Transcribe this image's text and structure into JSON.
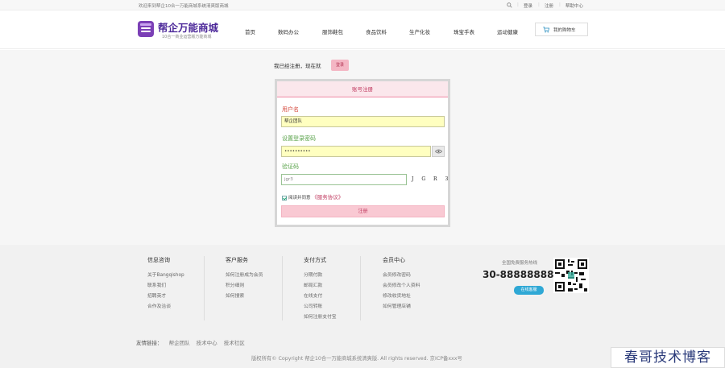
{
  "topbar": {
    "welcome": "欢迎来到帮企10合一万能商城系统清爽版商城",
    "login": "登录",
    "register": "注册",
    "help": "帮助中心"
  },
  "header": {
    "logo_name": "帮企万能商城",
    "logo_sub": "10合一商业运营版万能商城",
    "nav": [
      "首页",
      "数码办公",
      "服饰鞋包",
      "食品饮料",
      "生产化妆",
      "珠宝手表",
      "运动健康"
    ],
    "cart_label": "我的购物车"
  },
  "main": {
    "already_text": "我已经注册，现在就",
    "login_button": "登录",
    "tab_title": "账号注册",
    "username_label": "用户名",
    "username_value": "帮企团队",
    "password_label": "设置登录密码",
    "password_value": "••••••••••",
    "captcha_label": "验证码",
    "captcha_value": "jgr3",
    "captcha_image_text": "J G R 3",
    "agree_text": "阅读并同意",
    "terms_link": "《服务协议》",
    "submit_label": "注册"
  },
  "footer": {
    "columns": [
      {
        "title": "信息咨询",
        "links": [
          "关于Bangqishop",
          "联系我们",
          "招聘英才",
          "合作及洽谈"
        ]
      },
      {
        "title": "客户服务",
        "links": [
          "如何注册成为会员",
          "积分细则",
          "如何搜索"
        ]
      },
      {
        "title": "支付方式",
        "links": [
          "分期付款",
          "邮局汇款",
          "在线支付",
          "公司转账",
          "如何注册支付宝"
        ]
      },
      {
        "title": "会员中心",
        "links": [
          "会员修改密码",
          "会员修改个人资料",
          "修改收货地址",
          "如何管理店铺"
        ]
      }
    ],
    "hotline_label": "全国免费服务热线",
    "hotline": "30-88888888",
    "online_button": "在线客服",
    "friend_title": "友情链接：",
    "friend_links": [
      "帮企团队",
      "技术中心",
      "技术社区"
    ],
    "copyright": "版权所有© Copyright 帮企10合一万能商城系统清爽版. All rights reserved. 京ICP备xxx号"
  },
  "watermark": "春哥技术博客"
}
